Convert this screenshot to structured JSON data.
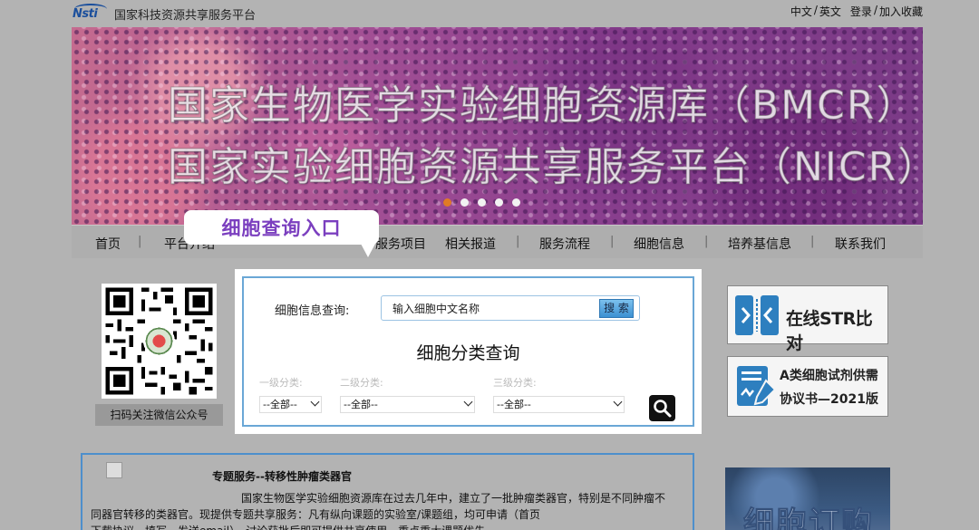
{
  "header": {
    "logo_mark": "Nsti",
    "site_name": "国家科技资源共享服务平台",
    "links": [
      "中文",
      "/",
      "英文",
      "登录",
      "/",
      "加入收藏"
    ]
  },
  "banner": {
    "line1": "国家生物医学实验细胞资源库（BMCR）",
    "line2": "国家实验细胞资源共享服务平台（NICR）",
    "slide_count": 5,
    "active_slide": 1
  },
  "nav": {
    "items": [
      "首页",
      "平台介绍",
      "服务项目",
      "相关报道",
      "服务流程",
      "细胞信息",
      "培养基信息",
      "联系我们"
    ],
    "separator": "|"
  },
  "callout": {
    "text": "细胞查询入口"
  },
  "qr": {
    "caption": "扫码关注微信公众号"
  },
  "search": {
    "label": "细胞信息查询:",
    "input_value": "输入细胞中文名称",
    "button": "搜 索"
  },
  "classify": {
    "title": "细胞分类查询",
    "levels": [
      {
        "label": "一级分类:",
        "selected": "--全部--"
      },
      {
        "label": "二级分类:",
        "selected": "--全部--"
      },
      {
        "label": "三级分类:",
        "selected": "--全部--"
      }
    ]
  },
  "ads": {
    "str_text": "在线STR比对",
    "agreement_line1": "A类细胞试剂供需",
    "agreement_line2": "协议书—2021版"
  },
  "service": {
    "title": "专题服务--转移性肿瘤类器官",
    "line1": "国家生物医学实验细胞资源库在过去几年中，建立了一批肿瘤类器官，特别是不同肿瘤不",
    "line2": "同器官转移的类器官。现提供专题共享服务：凡有纵向课题的实验室/课题组，均可申请（首页",
    "line3": "下载协议，填写，发送email），讨论获批后即可提供共享使用，重点重大课题优先。"
  },
  "promo": {
    "text": "细胞订购"
  },
  "colors": {
    "accent_blue": "#4d8fcc",
    "callout_purple": "#7b3fbf",
    "active_dot": "#e07b26"
  }
}
